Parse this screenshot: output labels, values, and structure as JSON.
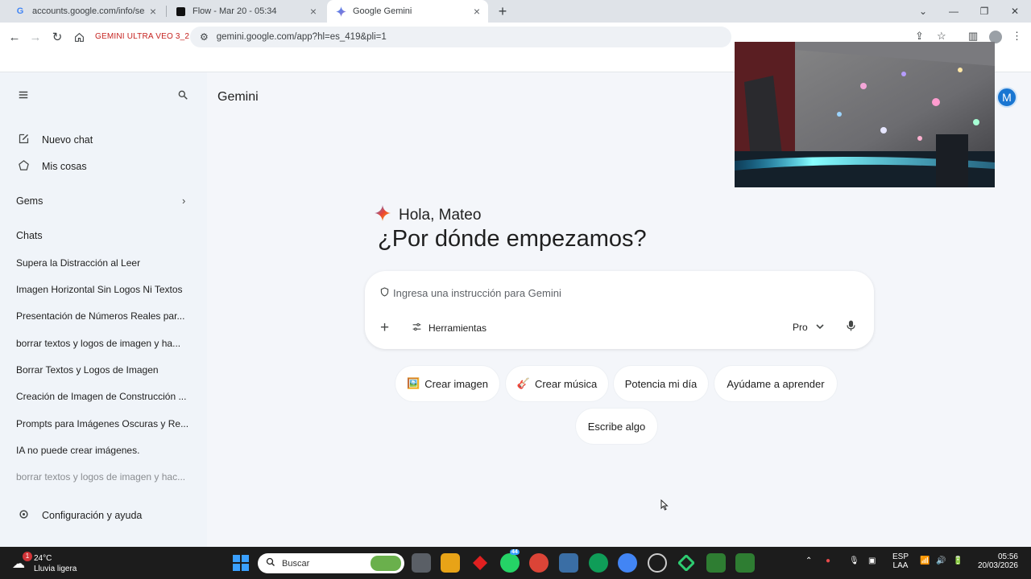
{
  "browser": {
    "tabs": [
      {
        "title": "accounts.google.com/info/sessi...",
        "favicon": "G"
      },
      {
        "title": "Flow - Mar 20 - 05:34",
        "favicon": "flow-square"
      },
      {
        "title": "Google Gemini",
        "favicon": "gemini-spark"
      }
    ],
    "bookmark": "GEMINI ULTRA VEO 3_2",
    "url": "gemini.google.com/app?hl=es_419&pli=1"
  },
  "sidebar": {
    "items": [
      {
        "label": "Nuevo chat",
        "icon": "edit-icon"
      },
      {
        "label": "Mis cosas",
        "icon": "mystuff-icon"
      }
    ],
    "gems_label": "Gems",
    "chats_label": "Chats",
    "chats": [
      "Supera la Distracción al Leer",
      "Imagen Horizontal Sin Logos Ni Textos",
      "Presentación de Números Reales par...",
      "borrar textos y logos de imagen y ha...",
      "Borrar Textos y Logos de Imagen",
      "Creación de Imagen de Construcción ...",
      "Prompts para Imágenes Oscuras y Re...",
      "IA no puede crear imágenes.",
      "borrar textos y logos de imagen y hac..."
    ],
    "settings_label": "Configuración y ayuda"
  },
  "main": {
    "app_title": "Gemini",
    "avatar_letter": "M",
    "greeting": "Hola, Mateo",
    "headline": "¿Por dónde empezamos?",
    "prompt_placeholder": "Ingresa una instrucción para Gemini",
    "tools_label": "Herramientas",
    "model_label": "Pro",
    "chips": [
      {
        "label": "Crear imagen",
        "icon": "🖼️"
      },
      {
        "label": "Crear música",
        "icon": "🎸"
      },
      {
        "label": "Potencia mi día",
        "icon": ""
      },
      {
        "label": "Ayúdame a aprender",
        "icon": ""
      },
      {
        "label": "Escribe algo",
        "icon": ""
      }
    ]
  },
  "taskbar": {
    "weather_temp": "24°C",
    "weather_desc": "Lluvia ligera",
    "weather_badge": "1",
    "search_placeholder": "Buscar",
    "whatsapp_badge": "44",
    "lang_top": "ESP",
    "lang_bottom": "LAA",
    "time": "05:56",
    "date": "20/03/2026"
  },
  "colors": {
    "sidebar_bg": "#f0f4f9",
    "main_bg": "#f4f6fa",
    "avatar_bg": "#1976d2",
    "taskbar_bg": "#1c1c1c",
    "bookmark_text": "#c5221f"
  }
}
